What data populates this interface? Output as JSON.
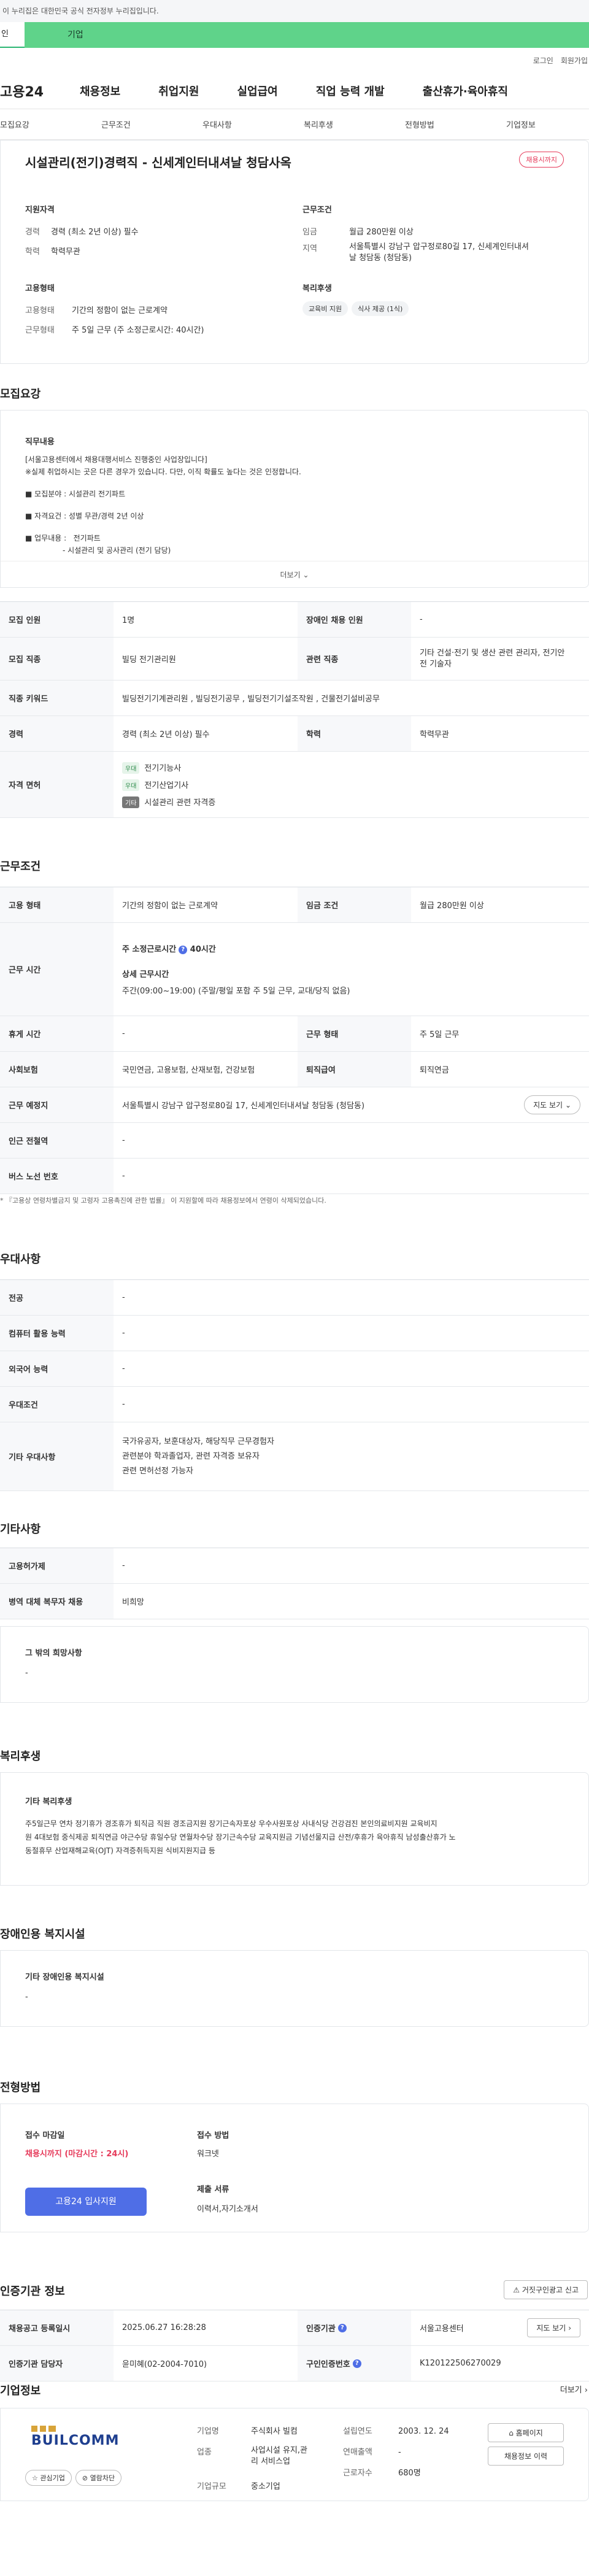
{
  "topbar": {
    "notice": "이 누리집은 대한민국 공식 전자정부 누리집입니다."
  },
  "greenbar": {
    "left": "인",
    "right": "기업"
  },
  "util": {
    "login": "로그인",
    "signup": "회원가입"
  },
  "gnb": {
    "logo": "고용24",
    "items": [
      "채용정보",
      "취업지원",
      "실업급여",
      "직업 능력 개발",
      "출산휴가·육아휴직"
    ]
  },
  "tabs": [
    "모집요강",
    "근무조건",
    "우대사항",
    "복리후생",
    "전형방법",
    "기업정보"
  ],
  "summary": {
    "title": "시설관리(전기)경력직 - 신세계인터내셔날 청담사옥",
    "status": "채용시까지",
    "qual_h": "지원자격",
    "career_k": "경력",
    "career_v": "경력 (최소 2년 이상) 필수",
    "edu_k": "학력",
    "edu_v": "학력무관",
    "cond_h": "근무조건",
    "wage_k": "임금",
    "wage_v": "월급 280만원 이상",
    "region_k": "지역",
    "region_v1": "서울특별시 강남구 압구정로80길 17, 신세계인터내셔",
    "region_v2": "날 청담동 (청담동)",
    "emp_h": "고용형태",
    "emptype_k": "고용형태",
    "emptype_v": "기간의 정함이 없는 근로계약",
    "shift_k": "근무형태",
    "shift_v": "주 5일 근무 (주 소정근로시간: 40시간)",
    "welfare_h": "복리후생",
    "chips": [
      "교육비 지원",
      "식사 제공 (1식)"
    ]
  },
  "recruit": {
    "title": "모집요강",
    "duty_h": "직무내용",
    "duty_lines": [
      "[서울고용센터에서 채용대행서비스 진행중인 사업장입니다]",
      "※실제 취업하시는 곳은 다른 경우가 있습니다. 다만, 이직 확률도 높다는 것은 인정합니다.",
      "■ 모집분야 : 시설관리 전기파트",
      "■ 자격요건 : 성별 무관/경력 2년 이상",
      "■ 업무내용 :   전기파트",
      "                - 시설관리 및 공사관리 (전기 담당)"
    ],
    "more": "더보기",
    "rows": {
      "count_k": "모집 인원",
      "count_v": "1명",
      "disab_k": "장애인 채용 인원",
      "disab_v": "-",
      "job_k": "모집 직종",
      "job_v": "빌딩 전기관리원",
      "related_k": "관련 직종",
      "related_v1": "기타 건설·전기 및 생산 관련 관리자, 전기안",
      "related_v2": "전 기술자",
      "kw_k": "직종 키워드",
      "kw_v": "빌딩전기기계관리원 , 빌딩전기공무 , 빌딩전기기설조작원 , 건물전기설비공무",
      "exp_k": "경력",
      "exp_v": "경력 (최소 2년 이상) 필수",
      "edu_k": "학력",
      "edu_v": "학력무관",
      "license_k": "자격 면허",
      "lic1_tag": "우대",
      "lic1": "전기기능사",
      "lic2_tag": "우대",
      "lic2": "전기산업기사",
      "lic3_tag": "기타",
      "lic3": "시설관리 관련 자격증"
    }
  },
  "work": {
    "title": "근무조건",
    "emp_k": "고용 형태",
    "emp_v": "기간의 정함이 없는 근로계약",
    "wage_k": "임금 조건",
    "wage_v": "월급 280만원 이상",
    "time_k": "근무 시간",
    "time_h1": "주 소정근로시간",
    "time_v1": "40시간",
    "time_h2": "상세 근무시간",
    "time_v2": "주간(09:00~19:00) (주말/평일 포함 주 5일 근무, 교대/당직 없음)",
    "rest_k": "휴게 시간",
    "rest_v": "-",
    "type_k": "근무 형태",
    "type_v": "주 5일 근무",
    "ins_k": "사회보험",
    "ins_v": "국민연금, 고용보험, 산재보험, 건강보험",
    "ret_k": "퇴직급여",
    "ret_v": "퇴직연금",
    "place_k": "근무 예정지",
    "place_v": "서울특별시 강남구 압구정로80길 17, 신세계인터내셔날 청담동 (청담동)",
    "map": "지도 보기",
    "sub_k": "인근 전철역",
    "sub_v": "-",
    "bus_k": "버스 노선 번호",
    "bus_v": "-",
    "note": "* 『고용상 연령차별금지 및 고령자 고용촉진에 관한 법률』 이 지원할에 따라 채용정보에서 연령이 삭제되었습니다."
  },
  "pref": {
    "title": "우대사항",
    "major_k": "전공",
    "major_v": "-",
    "pc_k": "컴퓨터 활용 능력",
    "pc_v": "-",
    "lang_k": "외국어 능력",
    "lang_v": "-",
    "cond_k": "우대조건",
    "cond_v": "-",
    "etc_k": "기타 우대사항",
    "etc_v1": "국가유공자, 보훈대상자, 해당직무 근무경험자",
    "etc_v2": "관련분야 학과졸업자, 관련 자격증 보유자",
    "etc_v3": "관련 면허선정 가능자"
  },
  "other": {
    "title": "기타사항",
    "visa_k": "고용허가제",
    "visa_v": "-",
    "mil_k": "병역 대체 복무자 채용",
    "mil_v": "비희망",
    "hope_h": "그 밖의 희망사항",
    "hope_v": "-"
  },
  "welfare": {
    "title": "복리후생",
    "h": "기타 복리후생",
    "v1": "주5일근무 연차 정기휴가 경조휴가 퇴직금 직원 경조금지원 장기근속자포상 우수사원포상 사내식당 건강검진 본인의료비지원 교육비지",
    "v2": "원 4대보험 중식제공 퇴직연금 야근수당 휴일수당 연월차수당 장기근속수당 교육지원금 기념선물지급 산전/후휴가 육아휴직 남성출산휴가 노",
    "v3": "동절휴무 산업재해교육(OJT) 자격증취득지원 식비지원지급 등"
  },
  "disab": {
    "title": "장애인용 복지시설",
    "h": "기타 장애인용 복지시설",
    "v": "-"
  },
  "screen": {
    "title": "전형방법",
    "deadline_h": "접수 마감일",
    "deadline_v": "채용시까지 (마감시간 : 24시)",
    "method_h": "접수 방법",
    "method_v": "워크넷",
    "docs_h": "제출 서류",
    "docs_v": "이력서,자기소개서",
    "apply": "고용24 입사지원"
  },
  "cert": {
    "title": "인증기관 정보",
    "report": "거짓구인광고 신고",
    "reg_k": "채용공고 등록일시",
    "reg_v": "2025.06.27 16:28:28",
    "org_k": "인증기관",
    "org_v": "서울고용센터",
    "map": "지도 보기",
    "mgr_k": "인증기관 담당자",
    "mgr_v": "윤미혜(02-2004-7010)",
    "no_k": "구인인증번호",
    "no_v": "K120122506270029"
  },
  "company": {
    "title": "기업정보",
    "more": "더보기",
    "logo": "BUILCOMM",
    "fav": "관심기업",
    "block": "열람차단",
    "type_k": "기업명",
    "type_v": "주식회사 빌컴",
    "ind_k": "업종",
    "ind_v1": "사업시설 유지,관",
    "ind_v2": "리 서비스업",
    "size_k": "기업규모",
    "size_v": "중소기업",
    "est_k": "설립연도",
    "est_v": "2003. 12. 24",
    "sales_k": "연매출액",
    "sales_v": "-",
    "emp_k": "근로자수",
    "emp_v": "680명",
    "home": "홈페이지",
    "info": "채용정보 이력"
  },
  "colors": {
    "accent": "#4f6ee6",
    "red": "#e63a5a",
    "green": "#5fd38a"
  }
}
